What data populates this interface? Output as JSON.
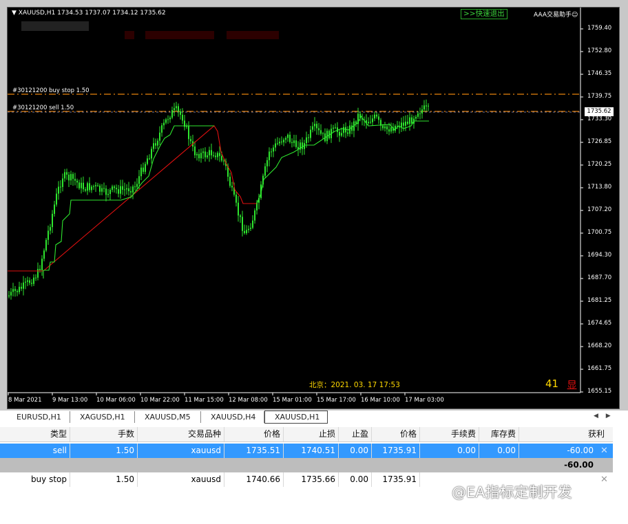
{
  "chart": {
    "symbol_header": "XAUUSD,H1  1734.53 1737.07 1734.12 1735.62",
    "exit_button": ">>快速退出",
    "assistant_label": "AAA交易助手☺",
    "y_ticks": [
      "1759.40",
      "1752.80",
      "1746.35",
      "1739.75",
      "1733.30",
      "1726.85",
      "1720.25",
      "1713.80",
      "1707.20",
      "1700.75",
      "1694.30",
      "1687.70",
      "1681.25",
      "1674.65",
      "1668.20",
      "1661.75",
      "1655.15"
    ],
    "x_ticks": [
      "8 Mar 2021",
      "9 Mar 13:00",
      "10 Mar 06:00",
      "10 Mar 22:00",
      "11 Mar 15:00",
      "12 Mar 08:00",
      "15 Mar 01:00",
      "15 Mar 17:00",
      "16 Mar 10:00",
      "17 Mar 03:00"
    ],
    "current_price": "1735.62",
    "order_lines": [
      {
        "label": "#30121200 buy stop 1.50",
        "color": "#e8820c"
      },
      {
        "label": "#30121200 sell 1.50",
        "color": "#e8820c"
      }
    ],
    "clock": "北京：2021. 03. 17  17:53",
    "count": "41",
    "display_button": "显",
    "colors": {
      "candle": "#2ee62e",
      "up_trail": "#2ee62e",
      "down_trail": "#e01010",
      "order_line": "#e8820c",
      "bid_line": "#7a7a9a"
    }
  },
  "tabs": [
    {
      "label": "EURUSD,H1",
      "active": false
    },
    {
      "label": "XAGUSD,H1",
      "active": false
    },
    {
      "label": "XAUUSD,M5",
      "active": false
    },
    {
      "label": "XAUUSD,H4",
      "active": false
    },
    {
      "label": "XAUUSD,H1",
      "active": true
    }
  ],
  "tab_nav": "◀ ▶",
  "table": {
    "headers": [
      "类型",
      "手数",
      "交易品种",
      "价格",
      "止损",
      "止盈",
      "价格",
      "手续费",
      "库存费",
      "获利"
    ],
    "rows": [
      {
        "cells": [
          "sell",
          "1.50",
          "xauusd",
          "1735.51",
          "1740.51",
          "0.00",
          "1735.91",
          "0.00",
          "0.00",
          "-60.00"
        ],
        "selected": true
      },
      {
        "summary": "-60.00"
      },
      {
        "cells": [
          "buy stop",
          "1.50",
          "xauusd",
          "1740.66",
          "1735.66",
          "0.00",
          "1735.91",
          "",
          "",
          ""
        ],
        "selected": false
      }
    ],
    "close_icon": "✕"
  },
  "watermark": "@EA指标定制开发"
}
